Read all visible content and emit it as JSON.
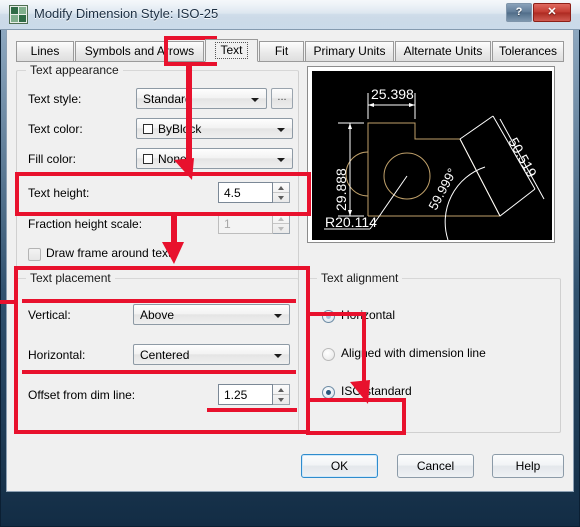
{
  "window": {
    "title": "Modify Dimension Style: ISO-25",
    "app_icon": "autocad-icon",
    "help_button": "?",
    "close_button": "✕"
  },
  "tabs": [
    {
      "label": "Lines",
      "selected": false
    },
    {
      "label": "Symbols and Arrows",
      "selected": false
    },
    {
      "label": "Text",
      "selected": true
    },
    {
      "label": "Fit",
      "selected": false
    },
    {
      "label": "Primary Units",
      "selected": false
    },
    {
      "label": "Alternate Units",
      "selected": false
    },
    {
      "label": "Tolerances",
      "selected": false
    }
  ],
  "text_appearance": {
    "title": "Text appearance",
    "text_style": {
      "label": "Text style:",
      "value": "Standard",
      "browse_button": "..."
    },
    "text_color": {
      "label": "Text color:",
      "value": "ByBlock"
    },
    "fill_color": {
      "label": "Fill color:",
      "value": "None"
    },
    "text_height": {
      "label": "Text height:",
      "value": "4.5"
    },
    "fraction_height_scale": {
      "label": "Fraction height scale:",
      "value": "1",
      "enabled": false
    },
    "draw_frame": {
      "label": "Draw frame around text",
      "checked": false
    }
  },
  "text_placement": {
    "title": "Text placement",
    "vertical": {
      "label": "Vertical:",
      "value": "Above"
    },
    "horizontal": {
      "label": "Horizontal:",
      "value": "Centered"
    },
    "offset": {
      "label": "Offset from dim line:",
      "value": "1.25"
    }
  },
  "text_alignment": {
    "title": "Text alignment",
    "options": [
      {
        "label": "Horizontal",
        "selected": false
      },
      {
        "label": "Aligned with dimension line",
        "selected": false
      },
      {
        "label": "ISO standard",
        "selected": true
      }
    ]
  },
  "preview": {
    "dim_linear_top": "25.398",
    "dim_linear_left": "29.888",
    "dim_radius": "R20.114",
    "dim_angular": "59.999°",
    "dim_aligned": "50.519",
    "background_color": "#000000",
    "geometry_color": "#bfa06a",
    "dim_color": "#ffffff"
  },
  "buttons": {
    "ok": "OK",
    "cancel": "Cancel",
    "help": "Help"
  },
  "annotations": {
    "highlight_color": "#e8112d",
    "highlighted": [
      "Text tab",
      "Text height",
      "Text placement",
      "ISO standard"
    ]
  }
}
